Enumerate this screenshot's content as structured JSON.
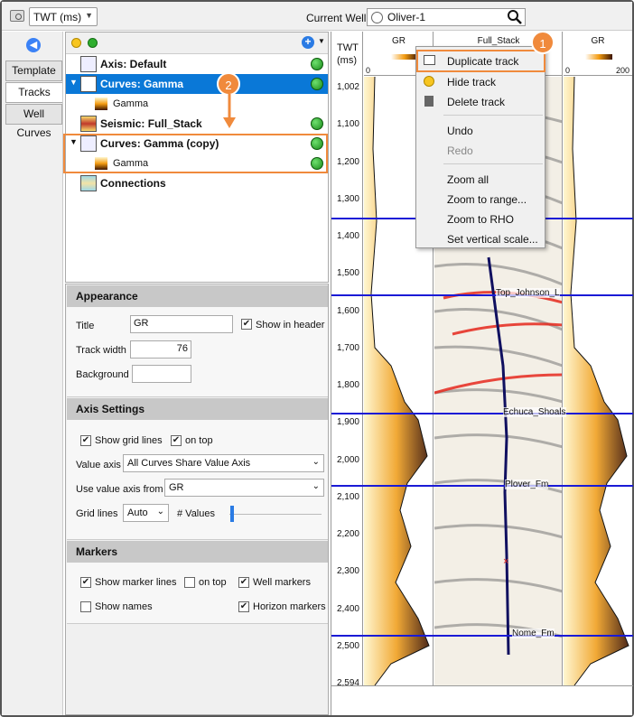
{
  "toolbar": {
    "time_select": "TWT (ms)",
    "current_well_label": "Current Well",
    "current_well_value": "Oliver-1"
  },
  "side_tabs": [
    "Template",
    "Tracks",
    "Well Curves"
  ],
  "tree": {
    "items": [
      {
        "label": "Axis: Default",
        "kind": "axis"
      },
      {
        "label": "Curves: Gamma",
        "kind": "curves"
      },
      {
        "label": "Gamma",
        "kind": "sub"
      },
      {
        "label": "Seismic: Full_Stack",
        "kind": "seismic"
      },
      {
        "label": "Curves: Gamma (copy)",
        "kind": "curves"
      },
      {
        "label": "Gamma",
        "kind": "sub"
      },
      {
        "label": "Connections",
        "kind": "connections"
      }
    ]
  },
  "callouts": [
    "1",
    "2"
  ],
  "appearance": {
    "header": "Appearance",
    "title_label": "Title",
    "title_value": "GR",
    "show_in_header_label": "Show in header",
    "track_width_label": "Track width",
    "track_width_value": "76",
    "background_label": "Background"
  },
  "axis_settings": {
    "header": "Axis Settings",
    "show_grid_lines": "Show grid lines",
    "on_top": "on top",
    "value_axis_label": "Value axis",
    "value_axis_value": "All Curves Share Value Axis",
    "use_value_axis_label": "Use value axis from",
    "use_value_axis_value": "GR",
    "grid_lines_label": "Grid lines",
    "grid_lines_value": "Auto",
    "values_label": "# Values"
  },
  "markers": {
    "header": "Markers",
    "show_marker_lines": "Show marker lines",
    "on_top": "on top",
    "well_markers": "Well markers",
    "show_names": "Show names",
    "horizon_markers": "Horizon markers"
  },
  "plot": {
    "axis_title_line1": "TWT",
    "axis_title_line2": "(ms)",
    "tracks": [
      {
        "name": "GR",
        "scale_left": "0",
        "scale_right": ""
      },
      {
        "name": "Full_Stack"
      },
      {
        "name": "GR",
        "scale_left": "0",
        "scale_right": "200"
      }
    ],
    "ticks": [
      "1,002",
      "1,100",
      "1,200",
      "1,300",
      "1,400",
      "1,500",
      "1,600",
      "1,700",
      "1,800",
      "1,900",
      "2,000",
      "2,100",
      "2,200",
      "2,300",
      "2,400",
      "2,500",
      "2,594"
    ],
    "markers": [
      "Top_Johnson_L",
      "Echuca_Shoals",
      "Plover_Fm",
      "Nome_Fm"
    ]
  },
  "context_menu": {
    "items": [
      "Duplicate track",
      "Hide track",
      "Delete track",
      "Undo",
      "Redo",
      "Zoom all",
      "Zoom to range...",
      "Zoom to RHO",
      "Set vertical scale..."
    ]
  }
}
